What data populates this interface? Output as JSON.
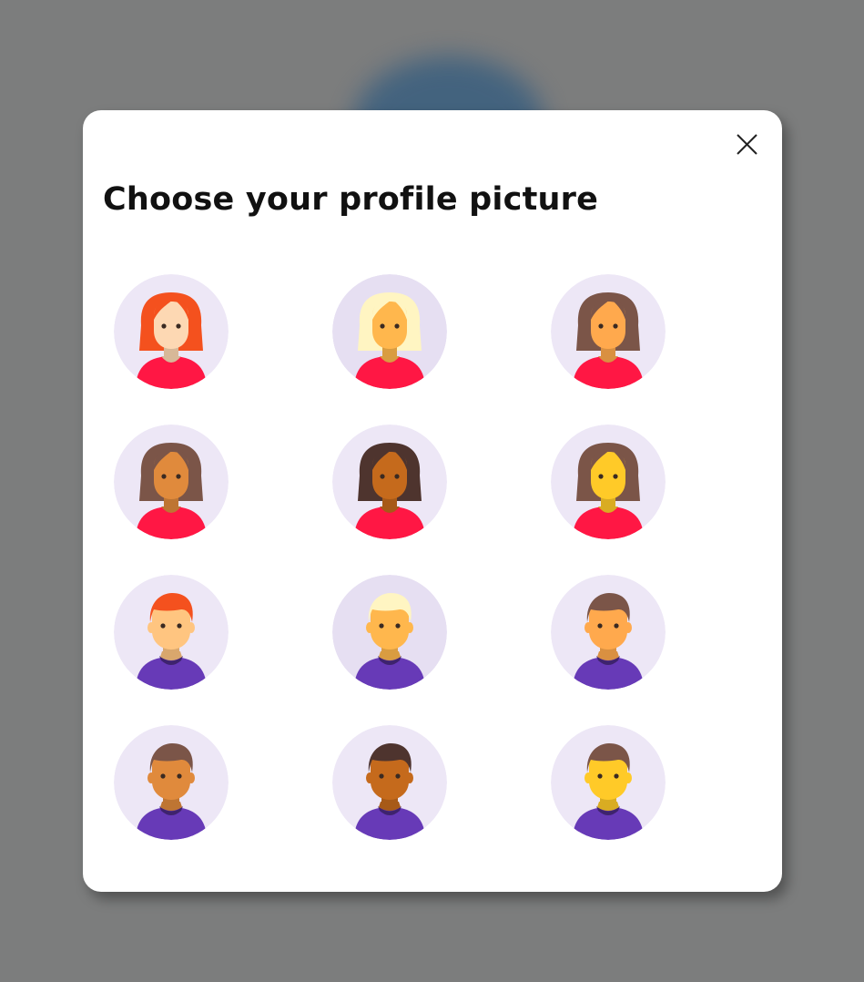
{
  "dialog": {
    "title": "Choose your profile picture",
    "close_icon": "close-icon"
  },
  "avatars": [
    {
      "gender": "female",
      "bg": "#ede7f6",
      "hair": "#f4511e",
      "skin": "#fdd8b3",
      "shirt": "#ff1744"
    },
    {
      "gender": "female",
      "bg": "#e6dff2",
      "hair": "#fff5c2",
      "skin": "#ffb74d",
      "shirt": "#ff1744"
    },
    {
      "gender": "female",
      "bg": "#ede7f6",
      "hair": "#7b5548",
      "skin": "#ffa94d",
      "shirt": "#ff1744"
    },
    {
      "gender": "female",
      "bg": "#ede7f6",
      "hair": "#7b5548",
      "skin": "#e08a3c",
      "shirt": "#ff1744"
    },
    {
      "gender": "female",
      "bg": "#ede7f6",
      "hair": "#4e342e",
      "skin": "#c56a1c",
      "shirt": "#ff1744"
    },
    {
      "gender": "female",
      "bg": "#ede7f6",
      "hair": "#7b5548",
      "skin": "#ffca28",
      "shirt": "#ff1744"
    },
    {
      "gender": "male",
      "bg": "#ede7f6",
      "hair": "#f4511e",
      "skin": "#ffc580",
      "shirt": "#673ab7"
    },
    {
      "gender": "male",
      "bg": "#e6dff2",
      "hair": "#fff5c2",
      "skin": "#ffb74d",
      "shirt": "#673ab7"
    },
    {
      "gender": "male",
      "bg": "#ede7f6",
      "hair": "#7b5548",
      "skin": "#ffa94d",
      "shirt": "#673ab7"
    },
    {
      "gender": "male",
      "bg": "#ede7f6",
      "hair": "#7b5548",
      "skin": "#e08a3c",
      "shirt": "#673ab7"
    },
    {
      "gender": "male",
      "bg": "#ede7f6",
      "hair": "#4e342e",
      "skin": "#c56a1c",
      "shirt": "#673ab7"
    },
    {
      "gender": "male",
      "bg": "#ede7f6",
      "hair": "#7b5548",
      "skin": "#ffca28",
      "shirt": "#673ab7"
    }
  ]
}
